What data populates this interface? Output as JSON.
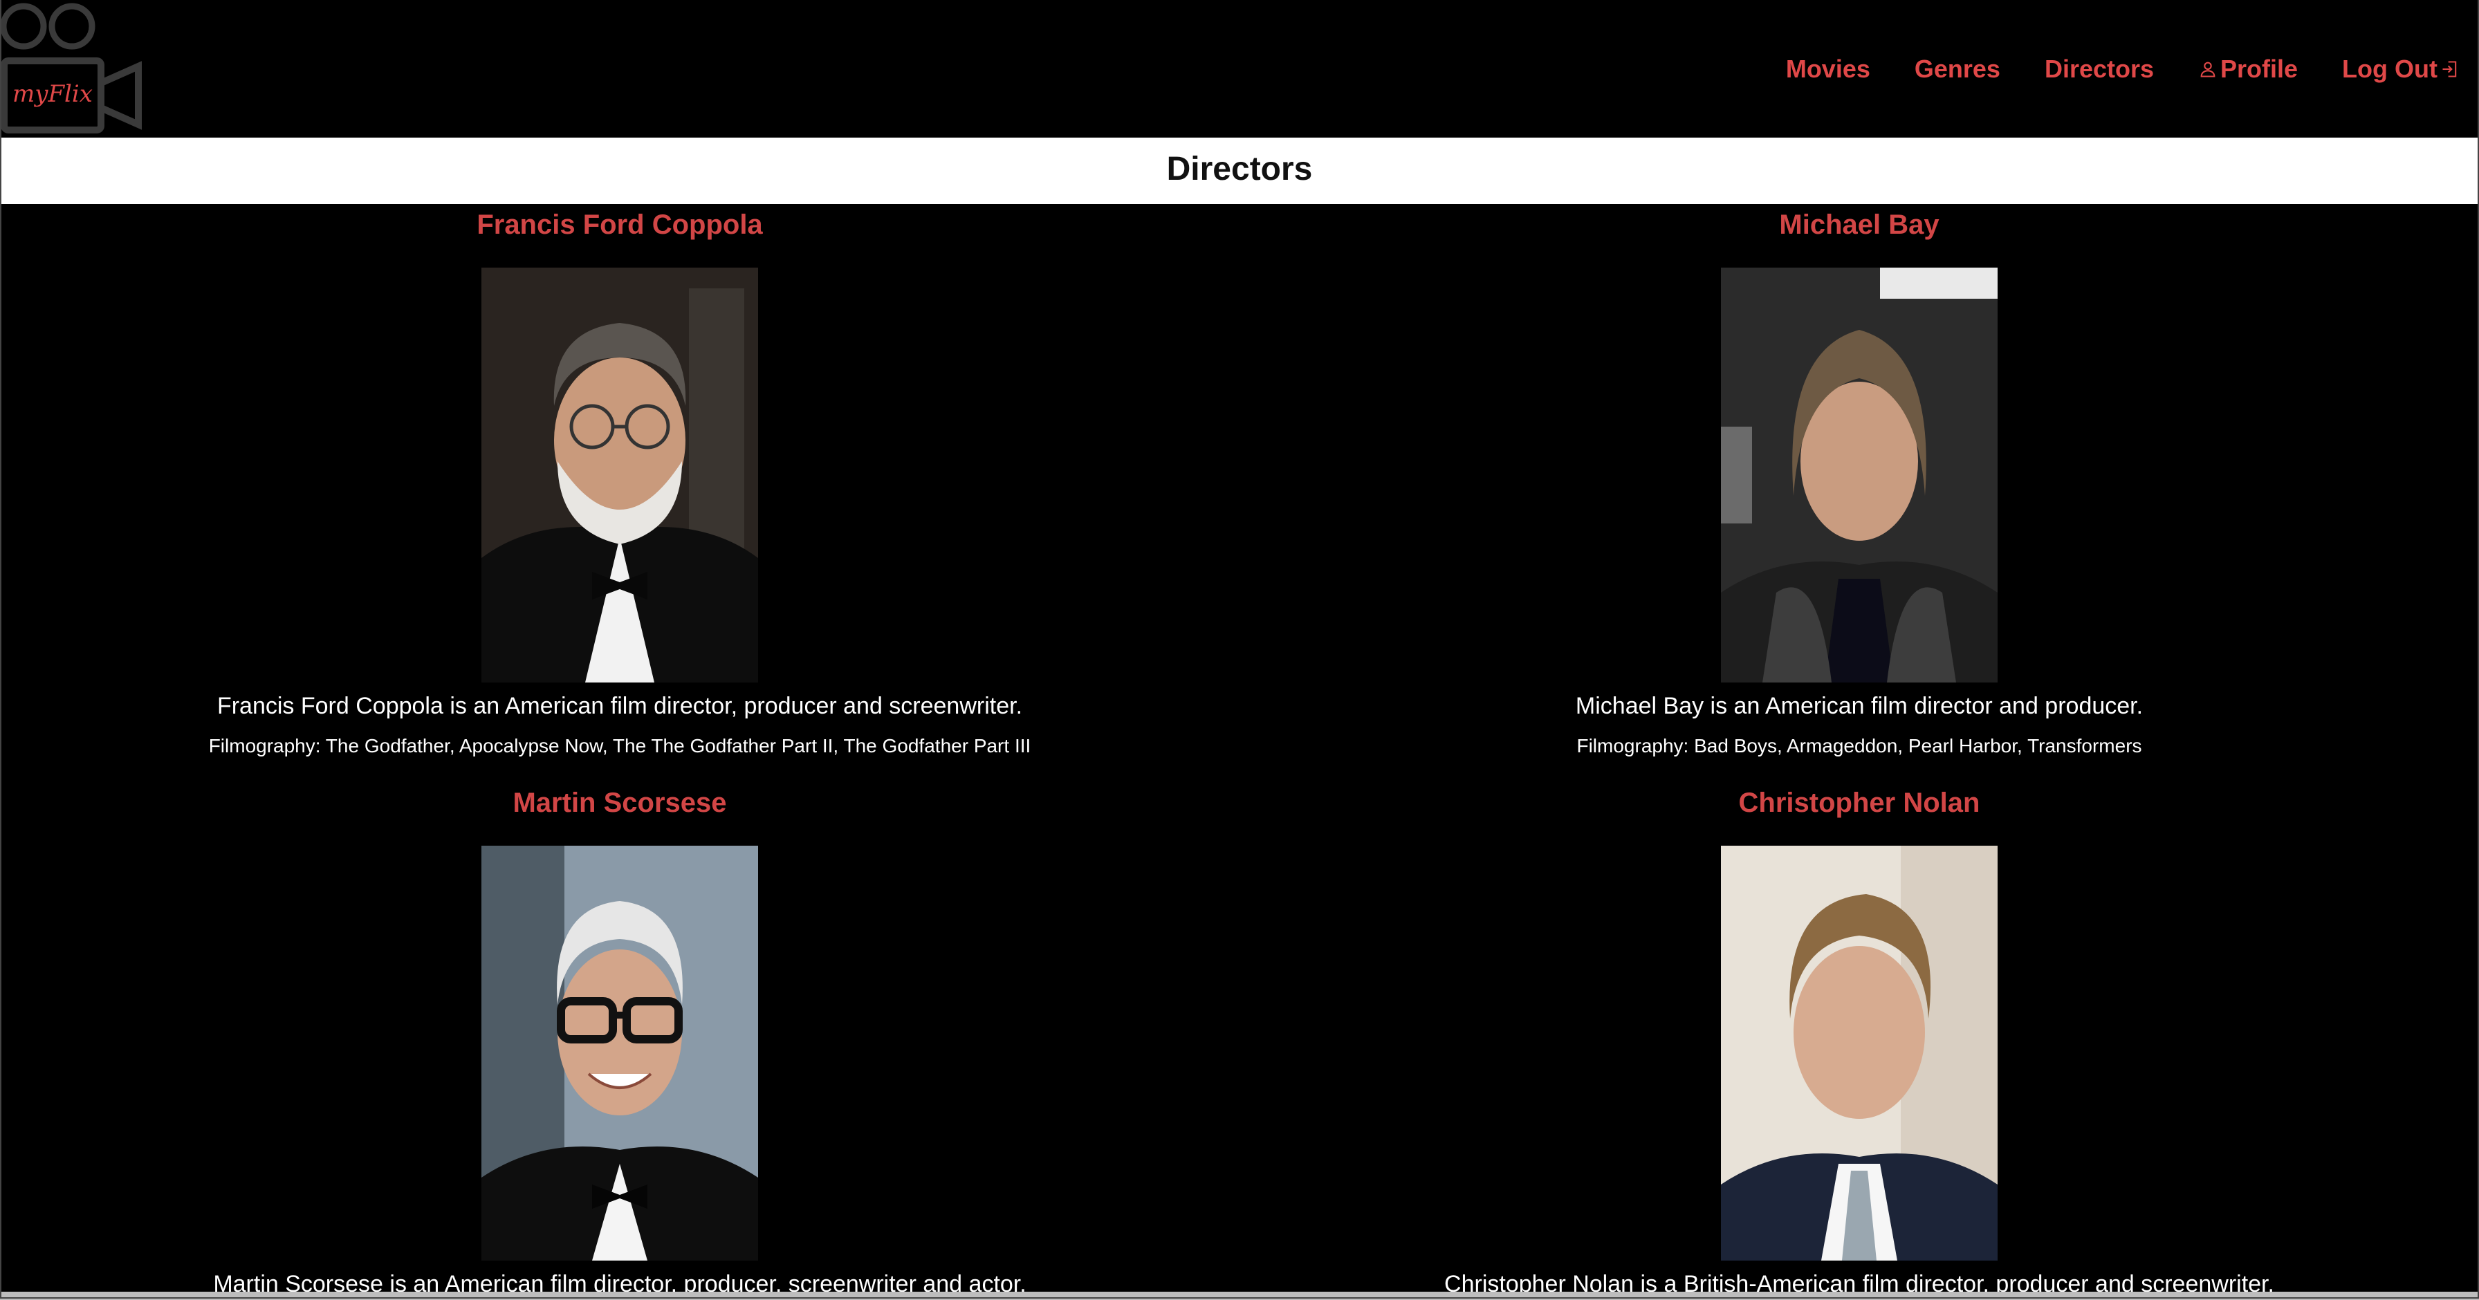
{
  "brand": {
    "logo_text": "myFlix",
    "accent_color": "#e04848"
  },
  "nav": {
    "items": [
      {
        "label": "Movies"
      },
      {
        "label": "Genres"
      },
      {
        "label": "Directors"
      },
      {
        "label": "Profile",
        "icon": "person-icon"
      },
      {
        "label": "Log Out",
        "icon": "logout-icon"
      }
    ]
  },
  "page": {
    "title": "Directors"
  },
  "directors": [
    {
      "name": "Francis Ford Coppola",
      "description": "Francis Ford Coppola is an American film director, producer and screenwriter.",
      "filmography": "Filmography: The Godfather, Apocalypse Now, The The Godfather Part II, The Godfather Part III",
      "photo": "portrait-elderly-man-grey-beard-glasses-tuxedo"
    },
    {
      "name": "Michael Bay",
      "description": "Michael Bay is an American film director and producer.",
      "filmography": "Filmography: Bad Boys, Armageddon, Pearl Harbor, Transformers",
      "photo": "portrait-man-long-hair-dark-scarf"
    },
    {
      "name": "Martin Scorsese",
      "description": "Martin Scorsese is an American film director, producer, screenwriter and actor.",
      "filmography": "",
      "photo": "portrait-man-white-hair-black-glasses-bowtie"
    },
    {
      "name": "Christopher Nolan",
      "description": "Christopher Nolan is a British-American film director, producer and screenwriter.",
      "filmography": "",
      "photo": "portrait-man-suit-tie"
    }
  ]
}
